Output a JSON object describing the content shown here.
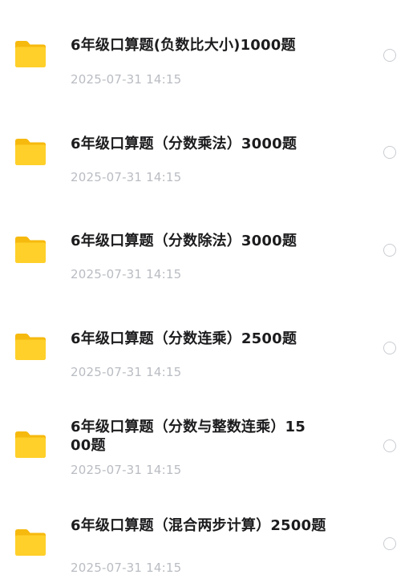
{
  "files": [
    {
      "name": "6年级口算题(负数比大小)1000题",
      "date": "2025-07-31 14:15",
      "icon": "folder-icon"
    },
    {
      "name": "6年级口算题（分数乘法）3000题",
      "date": "2025-07-31 14:15",
      "icon": "folder-icon"
    },
    {
      "name": "6年级口算题（分数除法）3000题",
      "date": "2025-07-31 14:15",
      "icon": "folder-icon"
    },
    {
      "name": "6年级口算题（分数连乘）2500题",
      "date": "2025-07-31 14:15",
      "icon": "folder-icon"
    },
    {
      "name": "6年级口算题（分数与整数连乘）1500题",
      "date": "2025-07-31 14:15",
      "icon": "folder-icon"
    },
    {
      "name": "6年级口算题（混合两步计算）2500题",
      "date": "2025-07-31 14:15",
      "icon": "folder-icon"
    }
  ],
  "colors": {
    "folder_body": "#FFD02A",
    "folder_back": "#F6B90E",
    "title_text": "#1C1C1E",
    "date_text": "#B9BCC2",
    "radio_border": "#C9CCD1"
  }
}
